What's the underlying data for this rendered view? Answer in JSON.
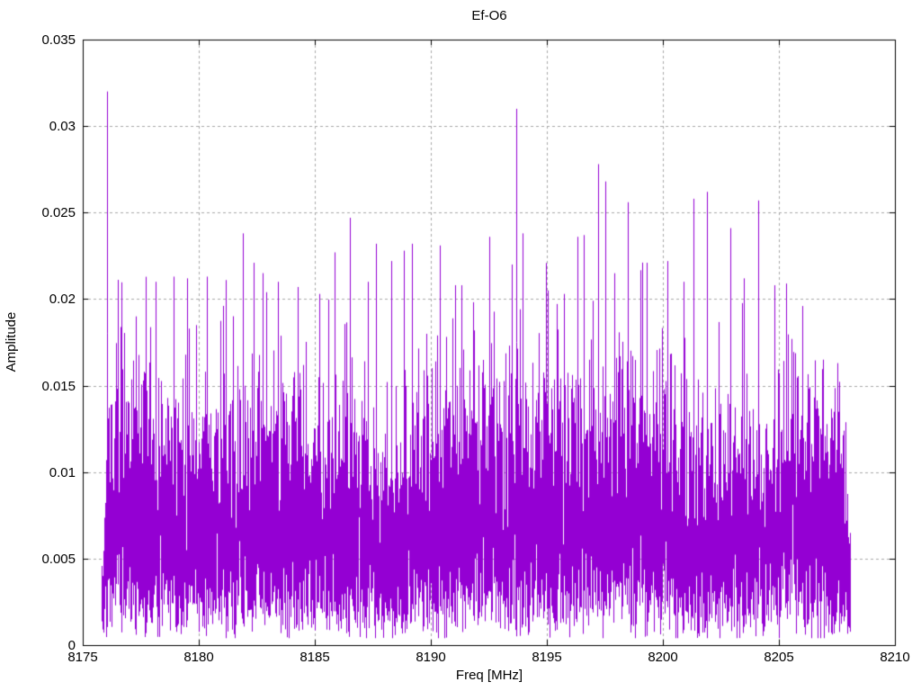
{
  "page": {
    "background": "#ffffff"
  },
  "chart_data": {
    "type": "line",
    "title": "Ef-O6",
    "xlabel": "Freq [MHz]",
    "ylabel": "Amplitude",
    "xlim": [
      8175,
      8210
    ],
    "ylim": [
      0,
      0.035
    ],
    "grid": true,
    "legend": "none",
    "line_color": "#9400d3",
    "grid_color": "#a8a8a8",
    "border_color": "#000000",
    "xticks": [
      {
        "value": 8175,
        "label": "8175"
      },
      {
        "value": 8180,
        "label": "8180"
      },
      {
        "value": 8185,
        "label": "8185"
      },
      {
        "value": 8190,
        "label": "8190"
      },
      {
        "value": 8195,
        "label": "8195"
      },
      {
        "value": 8200,
        "label": "8200"
      },
      {
        "value": 8205,
        "label": "8205"
      },
      {
        "value": 8210,
        "label": "8210"
      }
    ],
    "yticks": [
      {
        "value": 0,
        "label": "0"
      },
      {
        "value": 0.005,
        "label": "0.005"
      },
      {
        "value": 0.01,
        "label": "0.01"
      },
      {
        "value": 0.015,
        "label": "0.015"
      },
      {
        "value": 0.02,
        "label": "0.02"
      },
      {
        "value": 0.025,
        "label": "0.025"
      },
      {
        "value": 0.03,
        "label": "0.03"
      },
      {
        "value": 0.035,
        "label": "0.035"
      }
    ],
    "signal": {
      "description": "Dense noise-like magnitude spectrum occupying 8175.8-8208.1 MHz; solid band roughly 0.001-0.013 amplitude with hair spikes to ~0.02 and prominent peaks listed below",
      "freq_start": 8175.81,
      "freq_end": 8208.1,
      "noise_sigma": 0.0054,
      "draws_per_column": 8,
      "noise_max_clamp": 0.0225,
      "min_floor": 0.0004,
      "peak_base": 0.004,
      "left_taper_mhz": 0.25,
      "right_taper_mhz": 0.4,
      "seed": 98123,
      "peaks": [
        {
          "freq": 8176.05,
          "amp": 0.032
        },
        {
          "freq": 8177.3,
          "amp": 0.019
        },
        {
          "freq": 8178.15,
          "amp": 0.021
        },
        {
          "freq": 8178.9,
          "amp": 0.0213
        },
        {
          "freq": 8179.5,
          "amp": 0.0212
        },
        {
          "freq": 8180.35,
          "amp": 0.0213
        },
        {
          "freq": 8181.15,
          "amp": 0.0211
        },
        {
          "freq": 8181.9,
          "amp": 0.0238
        },
        {
          "freq": 8182.35,
          "amp": 0.0221
        },
        {
          "freq": 8182.75,
          "amp": 0.0215
        },
        {
          "freq": 8183.4,
          "amp": 0.021
        },
        {
          "freq": 8184.25,
          "amp": 0.0207
        },
        {
          "freq": 8185.2,
          "amp": 0.0203
        },
        {
          "freq": 8185.85,
          "amp": 0.0227
        },
        {
          "freq": 8186.5,
          "amp": 0.0247
        },
        {
          "freq": 8187.3,
          "amp": 0.021
        },
        {
          "freq": 8187.65,
          "amp": 0.0232
        },
        {
          "freq": 8188.3,
          "amp": 0.0222
        },
        {
          "freq": 8188.85,
          "amp": 0.0228
        },
        {
          "freq": 8189.2,
          "amp": 0.0232
        },
        {
          "freq": 8190.4,
          "amp": 0.0231
        },
        {
          "freq": 8191.3,
          "amp": 0.0208
        },
        {
          "freq": 8192.5,
          "amp": 0.0236
        },
        {
          "freq": 8193.5,
          "amp": 0.022
        },
        {
          "freq": 8193.7,
          "amp": 0.031
        },
        {
          "freq": 8193.95,
          "amp": 0.0238
        },
        {
          "freq": 8195.05,
          "amp": 0.0205
        },
        {
          "freq": 8195.75,
          "amp": 0.0203
        },
        {
          "freq": 8196.3,
          "amp": 0.0236
        },
        {
          "freq": 8196.6,
          "amp": 0.0237
        },
        {
          "freq": 8197.2,
          "amp": 0.0278
        },
        {
          "freq": 8197.5,
          "amp": 0.0268
        },
        {
          "freq": 8198.5,
          "amp": 0.0256
        },
        {
          "freq": 8199.3,
          "amp": 0.0221
        },
        {
          "freq": 8200.2,
          "amp": 0.0222
        },
        {
          "freq": 8200.9,
          "amp": 0.021
        },
        {
          "freq": 8201.3,
          "amp": 0.0258
        },
        {
          "freq": 8201.9,
          "amp": 0.0262
        },
        {
          "freq": 8202.9,
          "amp": 0.0241
        },
        {
          "freq": 8203.5,
          "amp": 0.0212
        },
        {
          "freq": 8204.1,
          "amp": 0.0257
        },
        {
          "freq": 8204.8,
          "amp": 0.0208
        },
        {
          "freq": 8205.3,
          "amp": 0.0209
        },
        {
          "freq": 8206.0,
          "amp": 0.0196
        },
        {
          "freq": 8206.9,
          "amp": 0.0165
        },
        {
          "freq": 8207.5,
          "amp": 0.0163
        }
      ]
    }
  }
}
